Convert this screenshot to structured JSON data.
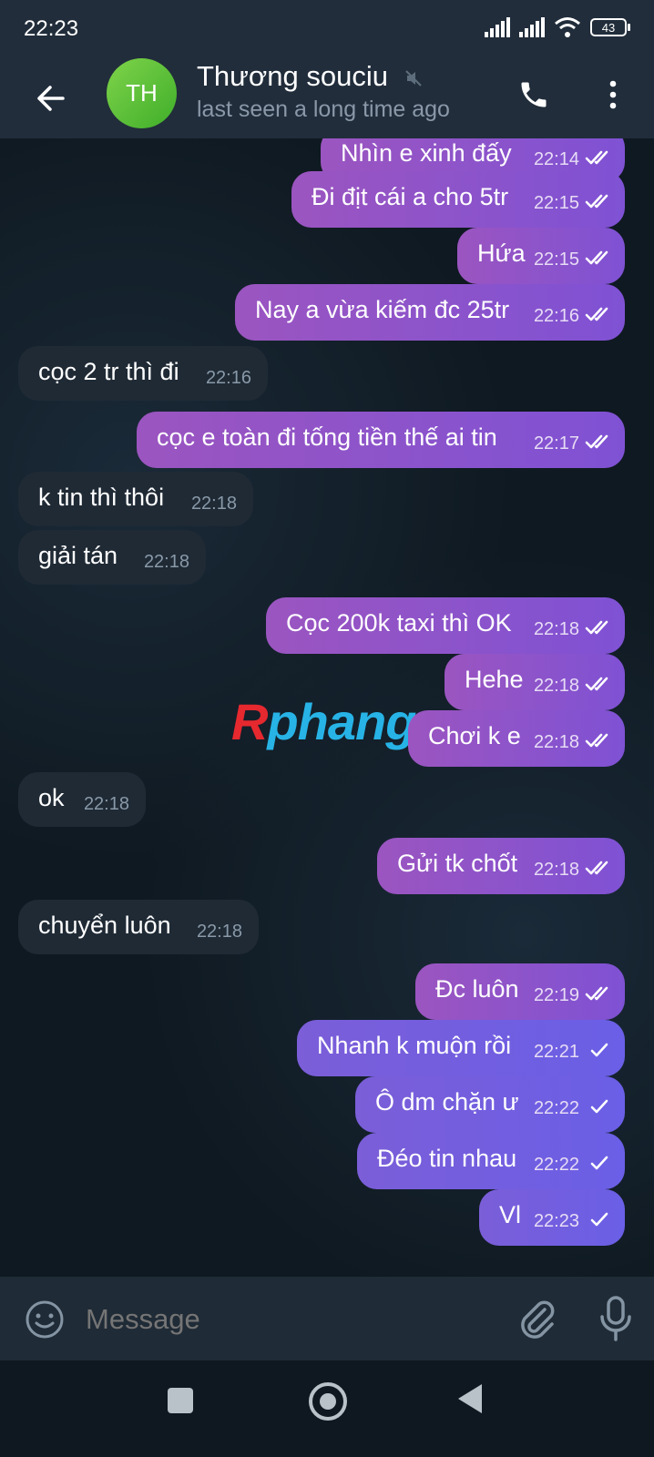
{
  "status_bar": {
    "time": "22:23",
    "battery": "43"
  },
  "header": {
    "avatar_initials": "TH",
    "contact_name": "Thương souciu",
    "contact_status": "last seen a long time ago"
  },
  "colors": {
    "header_bg": "#212d3b",
    "outgoing_bubble": "#8e52cc",
    "incoming_bubble": "#1f2a35",
    "avatar": "#5bc23a"
  },
  "messages": [
    {
      "direction": "out",
      "text": "Nhìn e xinh đấy",
      "time": "22:14",
      "status": "read"
    },
    {
      "direction": "out",
      "text": "Đi địt cái a cho 5tr",
      "time": "22:15",
      "status": "read"
    },
    {
      "direction": "out",
      "text": "Hứa",
      "time": "22:15",
      "status": "read"
    },
    {
      "direction": "out",
      "text": "Nay a vừa kiếm đc 25tr",
      "time": "22:16",
      "status": "read"
    },
    {
      "direction": "in",
      "text": "cọc 2 tr thì đi",
      "time": "22:16"
    },
    {
      "direction": "out",
      "text": "cọc e toàn đi tống tiền thế ai tin",
      "time": "22:17",
      "status": "read"
    },
    {
      "direction": "in",
      "text": "k tin thì thôi",
      "time": "22:18"
    },
    {
      "direction": "in",
      "text": "giải tán",
      "time": "22:18"
    },
    {
      "direction": "out",
      "text": "Cọc 200k taxi thì OK",
      "time": "22:18",
      "status": "read"
    },
    {
      "direction": "out",
      "text": "Hehe",
      "time": "22:18",
      "status": "read"
    },
    {
      "direction": "out",
      "text": "Chơi k e",
      "time": "22:18",
      "status": "read"
    },
    {
      "direction": "in",
      "text": "ok",
      "time": "22:18"
    },
    {
      "direction": "out",
      "text": "Gửi tk chốt",
      "time": "22:18",
      "status": "read"
    },
    {
      "direction": "in",
      "text": "chuyển luôn",
      "time": "22:18"
    },
    {
      "direction": "out",
      "text": "Đc luôn",
      "time": "22:19",
      "status": "read"
    },
    {
      "direction": "out",
      "text": "Nhanh k muộn rồi",
      "time": "22:21",
      "status": "sent"
    },
    {
      "direction": "out",
      "text": "Ô dm chặn ư",
      "time": "22:22",
      "status": "sent"
    },
    {
      "direction": "out",
      "text": "Đéo tin nhau",
      "time": "22:22",
      "status": "sent"
    },
    {
      "direction": "out",
      "text": "Vl",
      "time": "22:23",
      "status": "sent"
    }
  ],
  "watermark": {
    "first": "R",
    "rest": "phang"
  },
  "composer": {
    "placeholder": "Message"
  }
}
